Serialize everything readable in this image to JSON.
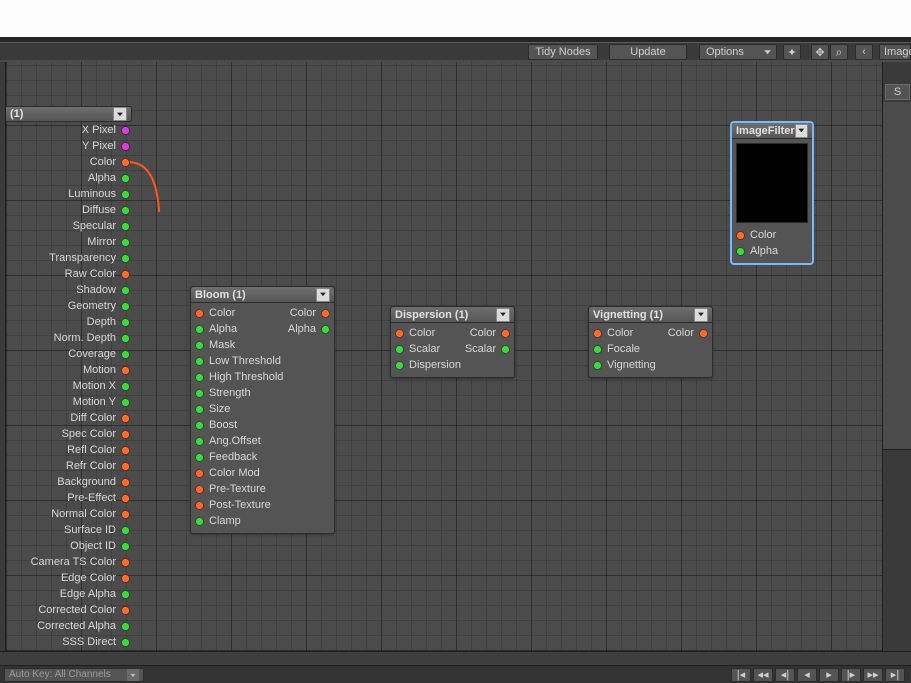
{
  "toolbar": {
    "tidy": "Tidy Nodes",
    "update": "Update",
    "options": "Options",
    "right_header": "Image",
    "right_sec": "S"
  },
  "source_node": {
    "title": "(1)",
    "outputs": [
      {
        "label": "X Pixel",
        "color": "magenta"
      },
      {
        "label": "Y Pixel",
        "color": "magenta"
      },
      {
        "label": "Color",
        "color": "orange"
      },
      {
        "label": "Alpha",
        "color": "green"
      },
      {
        "label": "Luminous",
        "color": "green"
      },
      {
        "label": "Diffuse",
        "color": "green"
      },
      {
        "label": "Specular",
        "color": "green"
      },
      {
        "label": "Mirror",
        "color": "green"
      },
      {
        "label": "Transparency",
        "color": "green"
      },
      {
        "label": "Raw Color",
        "color": "orange"
      },
      {
        "label": "Shadow",
        "color": "green"
      },
      {
        "label": "Geometry",
        "color": "green"
      },
      {
        "label": "Depth",
        "color": "green"
      },
      {
        "label": "Norm. Depth",
        "color": "green"
      },
      {
        "label": "Coverage",
        "color": "green"
      },
      {
        "label": "Motion",
        "color": "orange"
      },
      {
        "label": "Motion X",
        "color": "green"
      },
      {
        "label": "Motion Y",
        "color": "green"
      },
      {
        "label": "Diff Color",
        "color": "orange"
      },
      {
        "label": "Spec Color",
        "color": "orange"
      },
      {
        "label": "Refl Color",
        "color": "orange"
      },
      {
        "label": "Refr Color",
        "color": "orange"
      },
      {
        "label": "Background",
        "color": "orange"
      },
      {
        "label": "Pre-Effect",
        "color": "orange"
      },
      {
        "label": "Normal Color",
        "color": "orange"
      },
      {
        "label": "Surface ID",
        "color": "green"
      },
      {
        "label": "Object ID",
        "color": "green"
      },
      {
        "label": "Camera TS Color",
        "color": "orange"
      },
      {
        "label": "Edge Color",
        "color": "orange"
      },
      {
        "label": "Edge Alpha",
        "color": "green"
      },
      {
        "label": "Corrected Color",
        "color": "orange"
      },
      {
        "label": "Corrected Alpha",
        "color": "green"
      },
      {
        "label": "SSS Direct",
        "color": "green"
      }
    ]
  },
  "bloom": {
    "title": "Bloom (1)",
    "row0_in": "Color",
    "row0_out": "Color",
    "row1_in": "Alpha",
    "row1_out": "Alpha",
    "inputs": [
      {
        "label": "Mask",
        "color": "green"
      },
      {
        "label": "Low Threshold",
        "color": "green"
      },
      {
        "label": "High Threshold",
        "color": "green"
      },
      {
        "label": "Strength",
        "color": "green"
      },
      {
        "label": "Size",
        "color": "green"
      },
      {
        "label": "Boost",
        "color": "green"
      },
      {
        "label": "Ang.Offset",
        "color": "green"
      },
      {
        "label": "Feedback",
        "color": "green"
      },
      {
        "label": "Color Mod",
        "color": "orange"
      },
      {
        "label": "Pre-Texture",
        "color": "orange"
      },
      {
        "label": "Post-Texture",
        "color": "orange"
      },
      {
        "label": "Clamp",
        "color": "green"
      }
    ]
  },
  "dispersion": {
    "title": "Dispersion (1)",
    "row0_in": "Color",
    "row0_out": "Color",
    "row1_in": "Scalar",
    "row1_out": "Scalar",
    "inputs": [
      {
        "label": "Dispersion",
        "color": "green"
      }
    ]
  },
  "vignetting": {
    "title": "Vignetting (1)",
    "row0_in": "Color",
    "row0_out": "Color",
    "inputs": [
      {
        "label": "Focale",
        "color": "green"
      },
      {
        "label": "Vignetting",
        "color": "green"
      }
    ]
  },
  "imagefilter": {
    "title": "ImageFilter",
    "inputs": [
      {
        "label": "Color",
        "color": "orange"
      },
      {
        "label": "Alpha",
        "color": "green"
      }
    ]
  },
  "footer": {
    "combo": "Auto Key: All Channels"
  }
}
